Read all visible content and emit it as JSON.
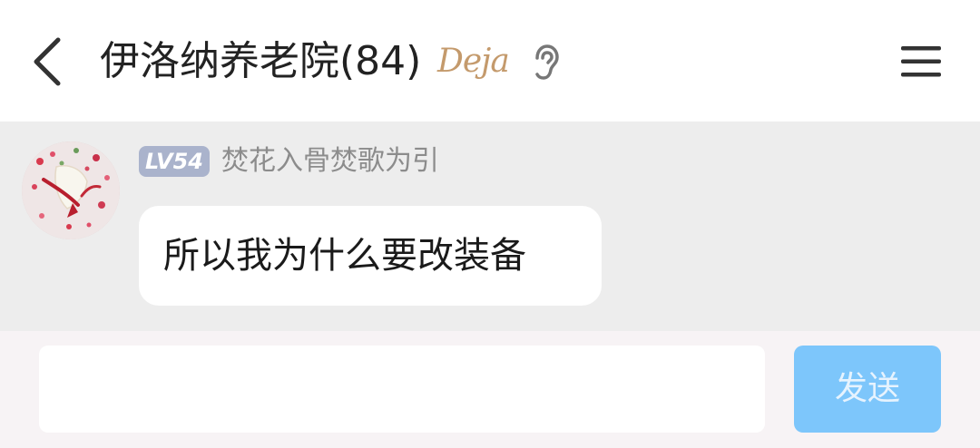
{
  "header": {
    "title": "伊洛纳养老院(84)",
    "badge_text": "Deja",
    "icons": {
      "back": "chevron-left-icon",
      "ear": "ear-icon",
      "menu": "hamburger-menu-icon"
    }
  },
  "messages": [
    {
      "level": "LV54",
      "nickname": "焚花入骨焚歌为引",
      "text": "所以我为什么要改装备",
      "avatar_icon": "avatar-image"
    }
  ],
  "composer": {
    "input_value": "",
    "send_label": "发送"
  },
  "colors": {
    "chat_background": "#ededed",
    "send_button": "#7dc6fb",
    "level_badge": "#aab3cc",
    "badge_gold": "#c49a6c"
  }
}
